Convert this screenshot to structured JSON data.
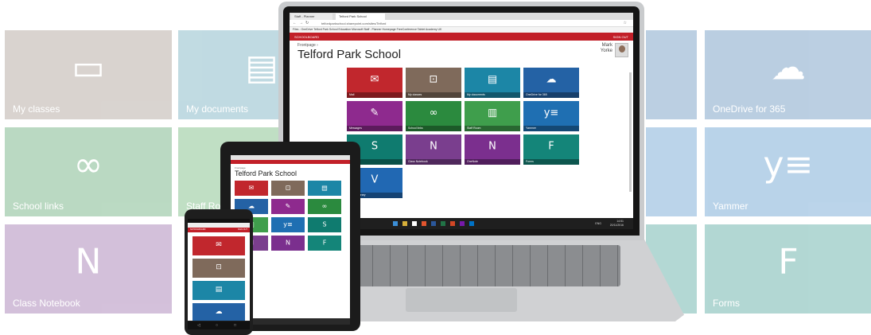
{
  "colors": {
    "red_bar": "#c21f28",
    "mail": "#c1272d",
    "classes": "#7f6a5b",
    "documents": "#1c86a6",
    "onedrive": "#2462a5",
    "messages": "#8e2a8e",
    "school_links": "#2b8a3e",
    "staff_room": "#3f9e4c",
    "yammer": "#1f6fb2",
    "sway": "#0f7b6f",
    "class_notebook": "#7a3e8e",
    "onenote": "#7b2f8e",
    "forms": "#148579",
    "video": "#2168b3"
  },
  "background_tiles": [
    {
      "label": "My classes",
      "icon": "presenter-icon",
      "glyph": "▭",
      "color": "#8a7a6d"
    },
    {
      "label": "My documents",
      "icon": "document-icon",
      "glyph": "▤",
      "color": "#3f8fa6"
    },
    {
      "label": "OneDrive for 365",
      "icon": "cloud-icon",
      "glyph": "☁",
      "color": "#2d6aa5"
    },
    {
      "label": "School links",
      "icon": "link-icon",
      "glyph": "∞",
      "color": "#2c8b43"
    },
    {
      "label": "Staff Ro",
      "icon": "book-icon",
      "glyph": "▥",
      "color": "#3f9e4c"
    },
    {
      "label": "Yammer",
      "icon": "yammer-icon",
      "glyph": "y",
      "color": "#2a78bd"
    },
    {
      "label": "Class Notebook",
      "icon": "notebook-icon",
      "glyph": "N",
      "color": "#7a3e8e"
    },
    {
      "label": "Forms",
      "icon": "forms-icon",
      "glyph": "F",
      "color": "#148579"
    }
  ],
  "browser": {
    "tabs": [
      "Staff - Planner",
      "Telford Park School"
    ],
    "url": "telfordparkschool.sharepoint.com/sites/Telford",
    "favorites": "Files - OneDrive   Telford Park School   Education   Microsoft   Staff - Planner   Homepage   FreeConference   Tablet Academy UK"
  },
  "app": {
    "brand": "SCHOOLBOARD",
    "sign_out": "SIGN OUT",
    "breadcrumb": "Frontpage ›",
    "title": "Telford Park School",
    "user_first": "Mark",
    "user_last": "Yorke"
  },
  "tiles": [
    {
      "label": "Mail",
      "icon": "mail-icon",
      "glyph": "✉",
      "color": "#c1272d"
    },
    {
      "label": "My classes",
      "icon": "presenter-icon",
      "glyph": "⊡",
      "color": "#7f6a5b"
    },
    {
      "label": "My documents",
      "icon": "document-icon",
      "glyph": "▤",
      "color": "#1c86a6"
    },
    {
      "label": "OneDrive for 365",
      "icon": "cloud-icon",
      "glyph": "☁",
      "color": "#2462a5"
    },
    {
      "label": "Messages",
      "icon": "messages-icon",
      "glyph": "✎",
      "color": "#8e2a8e"
    },
    {
      "label": "School links",
      "icon": "link-icon",
      "glyph": "∞",
      "color": "#2b8a3e"
    },
    {
      "label": "Staff Room",
      "icon": "book-icon",
      "glyph": "▥",
      "color": "#3f9e4c"
    },
    {
      "label": "Yammer",
      "icon": "yammer-icon",
      "glyph": "y≡",
      "color": "#1f6fb2"
    },
    {
      "label": "",
      "icon": "sway-icon",
      "glyph": "S",
      "color": "#0f7b6f"
    },
    {
      "label": "Class Notebook",
      "icon": "notebook-icon",
      "glyph": "N",
      "color": "#7a3e8e"
    },
    {
      "label": "OneNote",
      "icon": "onenote-icon",
      "glyph": "N",
      "color": "#7b2f8e"
    },
    {
      "label": "Forms",
      "icon": "forms-icon",
      "glyph": "F",
      "color": "#148579"
    },
    {
      "label": "Video Library",
      "icon": "video-icon",
      "glyph": "V",
      "color": "#2168b3"
    }
  ],
  "taskbar": {
    "time": "14:51",
    "date": "20/11/2016",
    "lang": "ENG"
  },
  "tablet": {
    "breadcrumb": "Frontpage",
    "title": "Telford Park School"
  },
  "phone": {
    "brand": "SCHOOLBOARD",
    "sign_out": "SIGN OUT"
  }
}
